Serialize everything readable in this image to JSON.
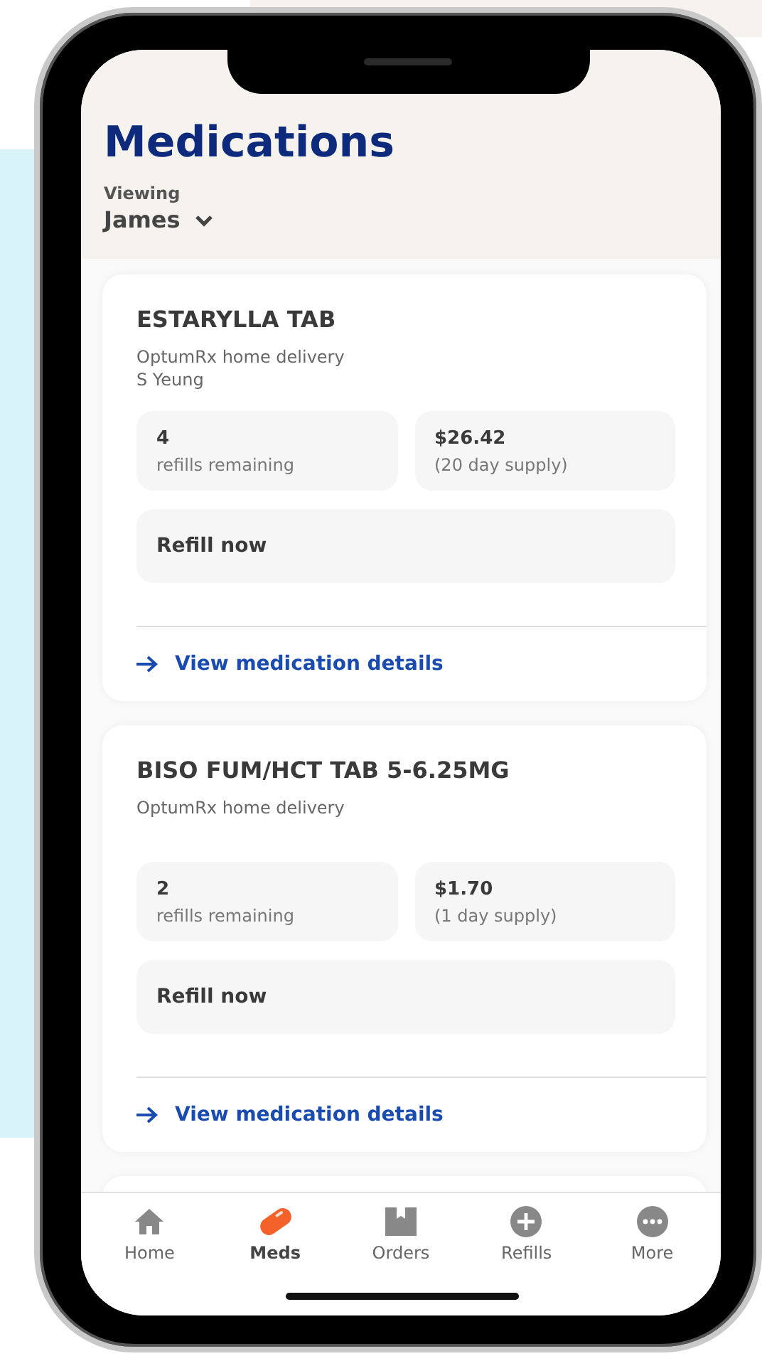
{
  "header": {
    "title": "Medications",
    "viewing_label": "Viewing",
    "member": "James"
  },
  "medications": [
    {
      "name": "ESTARYLLA TAB",
      "details": [
        "OptumRx home delivery",
        "S Yeung"
      ],
      "refills": "4",
      "refills_label": "refills remaining",
      "price": "$26.42",
      "supply": "(20 day supply)",
      "action": "Refill now",
      "link": "View medication details"
    },
    {
      "name": "BISO FUM/HCT TAB 5-6.25MG",
      "details": [
        "OptumRx home delivery"
      ],
      "refills": "2",
      "refills_label": "refills remaining",
      "price": "$1.70",
      "supply": "(1 day supply)",
      "action": "Refill now",
      "link": "View medication details"
    }
  ],
  "tab_bar": [
    {
      "label": "Home",
      "selected": false
    },
    {
      "label": "Meds",
      "selected": true
    },
    {
      "label": "Orders",
      "selected": false
    },
    {
      "label": "Refills",
      "selected": false
    },
    {
      "label": "More",
      "selected": false
    }
  ]
}
